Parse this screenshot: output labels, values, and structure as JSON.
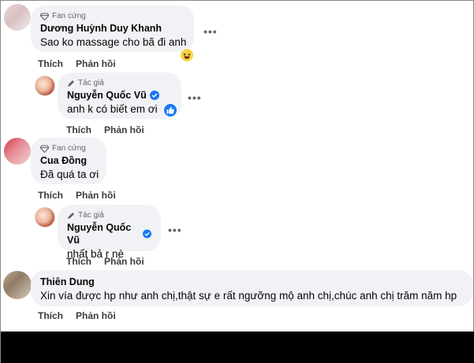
{
  "comments": [
    {
      "badge": "Fan cứng",
      "author": "Dương Huỳnh Duy Khanh",
      "text": "Sao ko massage cho bã đi anh",
      "reaction": "haha"
    },
    {
      "badge": "Tác giả",
      "author": "Nguyễn Quốc Vũ",
      "verified": true,
      "text": "anh k có biết em ơi",
      "reaction": "like"
    },
    {
      "badge": "Fan cứng",
      "author": "Cua Đồng",
      "text": "Đã quá ta ơi"
    },
    {
      "badge": "Tác giả",
      "author": "Nguyễn Quốc Vũ",
      "verified": true,
      "text": "nhất bả r nè"
    },
    {
      "author": "Thiên Dung",
      "text": "Xin vía được hp như anh chị,thật sự e rất ngưỡng mộ anh chị,chúc anh chị trăm năm hp"
    }
  ],
  "actions": {
    "like": "Thích",
    "reply": "Phản hồi"
  },
  "more_label": "•••",
  "colors": {
    "bubble": "#f0f2f5",
    "verified": "#1877f2",
    "meta": "#65676b"
  },
  "icons": {
    "fan": "diamond-icon",
    "author": "pencil-icon",
    "verified": "verified-check-icon",
    "haha": "haha-reaction-icon",
    "like": "like-reaction-icon"
  }
}
